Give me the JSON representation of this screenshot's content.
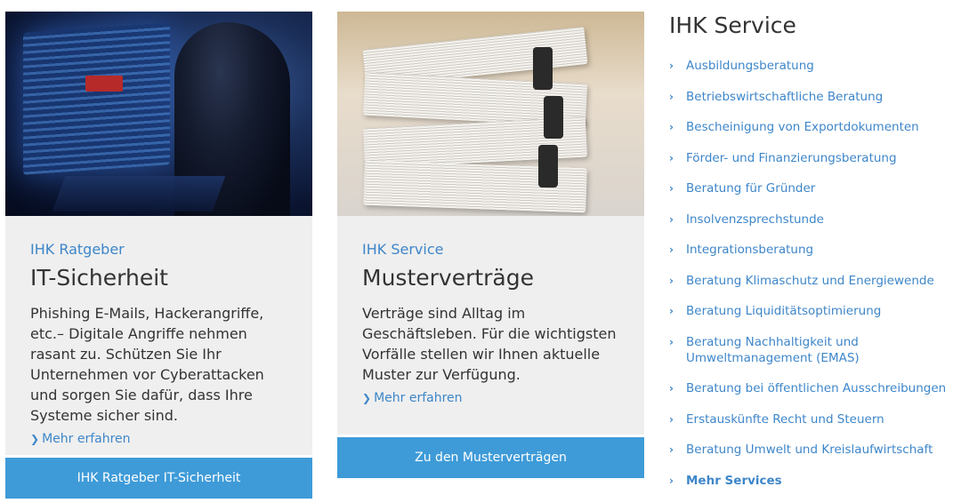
{
  "cards": [
    {
      "kicker": "IHK Ratgeber",
      "title": "IT-Sicherheit",
      "text": "Phishing E-Mails, Hackerangriffe, etc.– Digitale Angriffe nehmen rasant zu. Schützen Sie Ihr Unternehmen vor Cyberattacken und sorgen Sie dafür, dass Ihre Systeme sicher sind.",
      "link": "Mehr erfahren",
      "button": "IHK Ratgeber IT-Sicherheit"
    },
    {
      "kicker": "IHK Service",
      "title": "Musterverträge",
      "text": "Verträge sind Alltag im Geschäftsleben. Für die wichtigsten Vorfälle stellen wir Ihnen aktuelle Muster zur Verfügung.",
      "link": "Mehr erfahren",
      "button": "Zu den Musterverträgen"
    }
  ],
  "service": {
    "title": "IHK Service",
    "items": [
      "Ausbildungsberatung",
      "Betriebswirtschaftliche Beratung",
      "Bescheinigung von Exportdokumenten",
      "Förder- und Finanzierungsberatung",
      "Beratung für Gründer",
      "Insolvenzsprechstunde",
      "Integrationsberatung",
      "Beratung Klimaschutz und Energiewende",
      "Beratung Liquiditätsoptimierung",
      "Beratung Nachhaltigkeit und Umweltmanagement (EMAS)",
      "Beratung bei öffentlichen Ausschreibungen",
      "Erstauskünfte Recht und Steuern",
      "Beratung Umwelt und Kreislaufwirtschaft"
    ],
    "more": "Mehr Services"
  },
  "icons": {
    "chevron": "chevron-right-icon"
  },
  "colors": {
    "accent": "#3e86c9",
    "button": "#3e9bd8",
    "card_bg": "#efefef"
  }
}
